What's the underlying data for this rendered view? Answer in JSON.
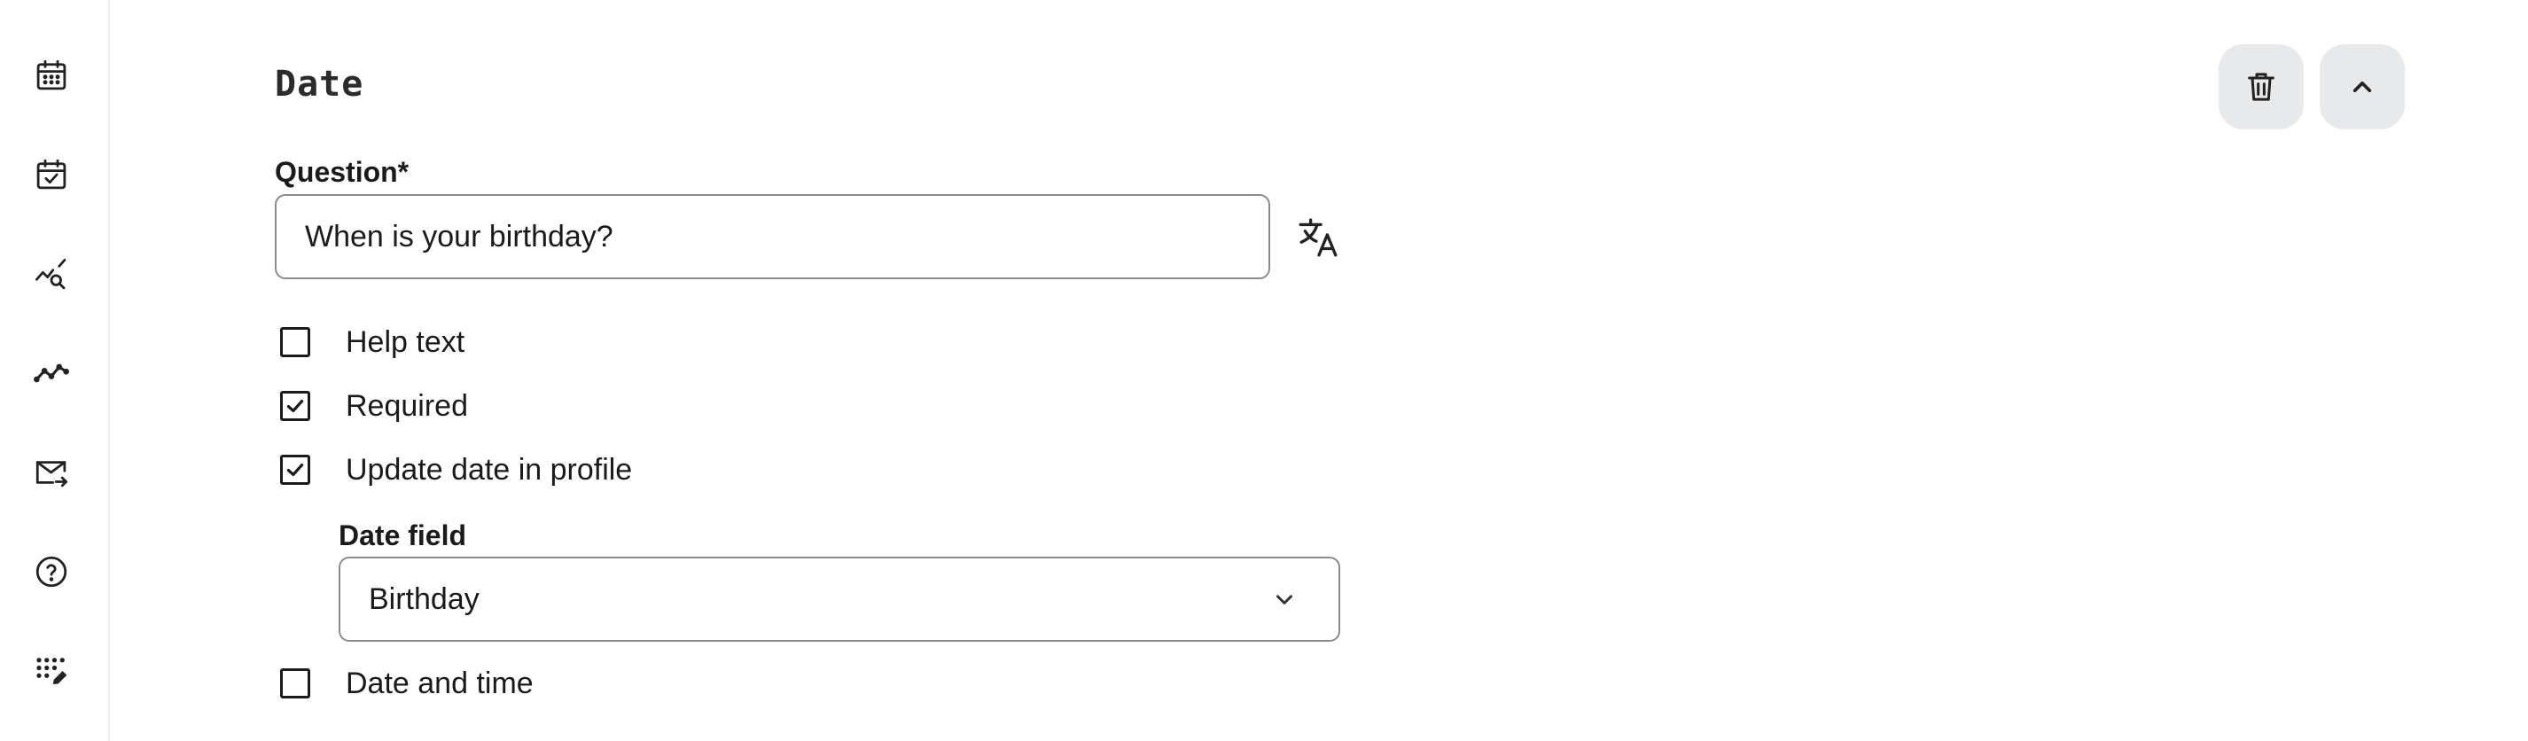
{
  "sidebar": {
    "items": [
      {
        "icon": "calendar-grid-icon"
      },
      {
        "icon": "calendar-check-icon"
      },
      {
        "icon": "chart-search-icon"
      },
      {
        "icon": "trend-line-icon"
      },
      {
        "icon": "mail-forward-icon"
      },
      {
        "icon": "help-circle-icon"
      },
      {
        "icon": "dots-pencil-icon"
      }
    ]
  },
  "section": {
    "title": "Date"
  },
  "actions": {
    "delete_icon": "trash-icon",
    "collapse_icon": "chevron-up-icon"
  },
  "question": {
    "label": "Question*",
    "value": "When is your birthday?",
    "translate_icon": "translate-icon"
  },
  "options": {
    "help_text": {
      "label": "Help text",
      "checked": false
    },
    "required": {
      "label": "Required",
      "checked": true
    },
    "update_profile": {
      "label": "Update date in profile",
      "checked": true
    },
    "date_and_time": {
      "label": "Date and time",
      "checked": false
    }
  },
  "date_field": {
    "label": "Date field",
    "selected": "Birthday"
  },
  "colors": {
    "button_bg": "#e8e9ea",
    "border": "#8c8c8c",
    "text": "#1a1a1a"
  }
}
